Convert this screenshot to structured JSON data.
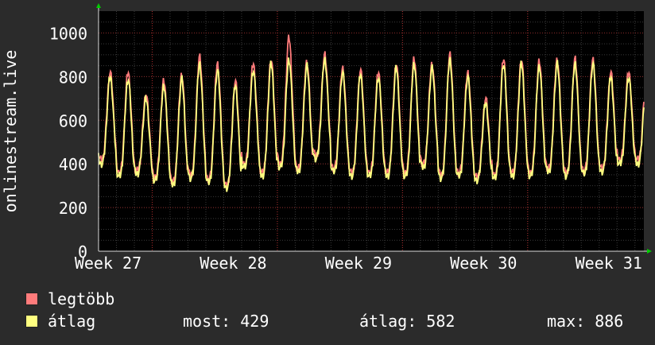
{
  "chart_data": {
    "type": "line",
    "ylabel": "onlinestream.live",
    "ylim": [
      0,
      1100
    ],
    "y_ticks": [
      "0",
      "200",
      "400",
      "600",
      "800",
      "1000"
    ],
    "x_ticks": [
      "Week 27",
      "Week 28",
      "Week 29",
      "Week 30",
      "Week 31"
    ],
    "grid": true,
    "x_days": 30.5,
    "series": [
      {
        "name": "legtöbb",
        "color": "#ff7b7b",
        "daily_peak": [
          820,
          820,
          720,
          780,
          810,
          890,
          860,
          780,
          860,
          880,
          980,
          870,
          900,
          840,
          830,
          820,
          860,
          880,
          860,
          900,
          820,
          700,
          880,
          880,
          870,
          880,
          880,
          880,
          820,
          820
        ],
        "daily_low": [
          420,
          360,
          370,
          340,
          320,
          350,
          330,
          300,
          400,
          360,
          400,
          380,
          440,
          380,
          360,
          360,
          360,
          360,
          400,
          350,
          360,
          340,
          350,
          360,
          360,
          380,
          360,
          370,
          380,
          420
        ]
      },
      {
        "name": "átlag",
        "color": "#ffff80",
        "daily_peak": [
          800,
          790,
          700,
          760,
          790,
          860,
          830,
          760,
          830,
          860,
          880,
          850,
          880,
          820,
          810,
          800,
          840,
          860,
          840,
          880,
          800,
          680,
          860,
          860,
          850,
          860,
          860,
          860,
          800,
          800
        ],
        "daily_low": [
          400,
          345,
          355,
          325,
          305,
          335,
          315,
          290,
          385,
          345,
          385,
          365,
          425,
          365,
          345,
          345,
          345,
          345,
          385,
          335,
          345,
          325,
          335,
          345,
          345,
          365,
          345,
          355,
          365,
          400
        ]
      }
    ]
  },
  "legend": {
    "items": [
      {
        "label": "legtöbb",
        "color": "#ff7b7b"
      },
      {
        "label": "átlag",
        "color": "#ffff80"
      }
    ],
    "stats": {
      "now": "most: 429",
      "avg": "átlag: 582",
      "max": "max: 886"
    }
  }
}
